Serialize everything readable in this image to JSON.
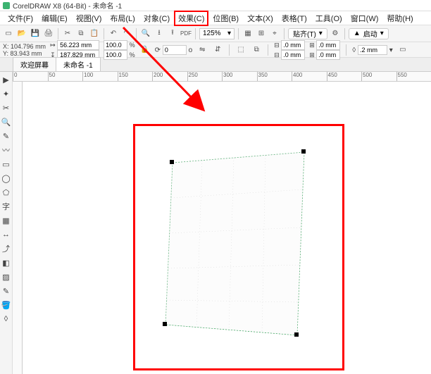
{
  "app": {
    "title": "CorelDRAW X8 (64-Bit) - 未命名 -1"
  },
  "menu": {
    "file": "文件(F)",
    "edit": "编辑(E)",
    "view": "视图(V)",
    "layout": "布局(L)",
    "object": "对象(C)",
    "effect": "效果(C)",
    "bitmap": "位图(B)",
    "text": "文本(X)",
    "table": "表格(T)",
    "tools": "工具(O)",
    "window": "窗口(W)",
    "help": "帮助(H)"
  },
  "toolbar": {
    "zoom": "125%",
    "snap": "贴齐(T)",
    "launch": "启动"
  },
  "propbar": {
    "x_label": "X:",
    "x_val": "104.796 mm",
    "y_label": "Y:",
    "y_val": "83.943 mm",
    "w_val": "56.223 mm",
    "h_val": "187.829 mm",
    "sx_val": "100.0",
    "sy_val": "100.0",
    "pct": "%",
    "rot": "0",
    "deg": "o",
    "out_x": ".0 mm",
    "out_y": ".0 mm",
    "pad_x": ".0 mm",
    "pad_y": ".0 mm",
    "stroke": ".2 mm"
  },
  "tabs": {
    "welcome": "欢迎屏幕",
    "doc": "未命名 -1"
  },
  "ruler": [
    "0",
    "50",
    "100",
    "150",
    "200",
    "250",
    "300",
    "350",
    "400",
    "450",
    "500",
    "550"
  ]
}
